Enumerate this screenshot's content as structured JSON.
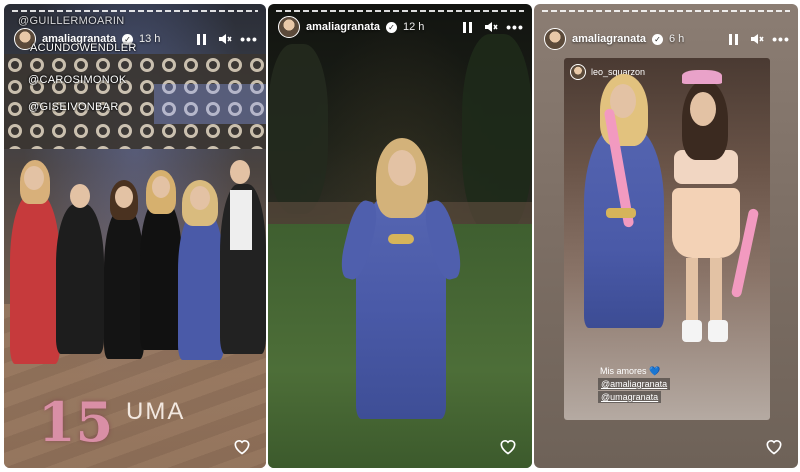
{
  "story1": {
    "username": "amaliagranata",
    "time": "13 h",
    "mentions": [
      "@GUILLERMOARIN",
      "ACUNDOWENDLER",
      "@CAROSIMONOK",
      "@GISEIVONBAR"
    ],
    "overlay_number": "15",
    "overlay_name": "UMA"
  },
  "story2": {
    "username": "amaliagranata",
    "time": "12 h"
  },
  "story3": {
    "username": "amaliagranata",
    "time": "6 h",
    "inner_username": "leo_squarzon",
    "caption": "Mis amores",
    "mentions": [
      "@amaliagranata",
      "@umagranata"
    ]
  },
  "icons": {
    "pause": "pause-icon",
    "mute": "speaker-muted-icon",
    "more": "more-dots-icon",
    "like": "heart-icon",
    "verified": "verified-badge-icon"
  },
  "colors": {
    "accent_blue_dress": "#4a5aa8",
    "pink_boa": "#f29ac0"
  }
}
